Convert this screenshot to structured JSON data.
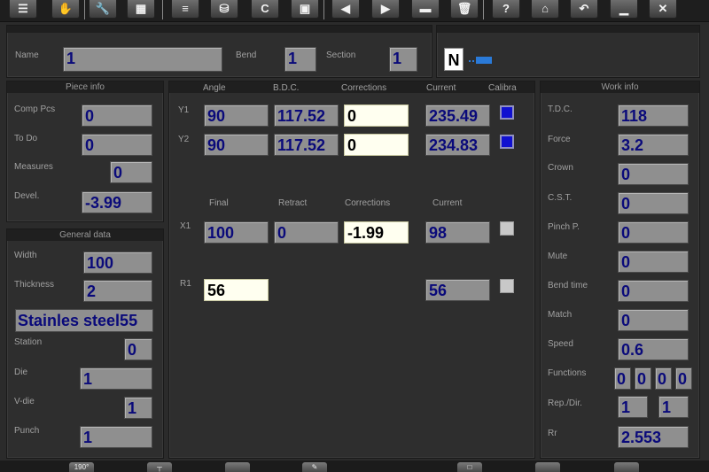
{
  "toolbar": {
    "icons": [
      "list-icon",
      "hand-icon",
      "wrench-icon",
      "calculator-icon",
      "layers-icon",
      "database-icon",
      "c-icon",
      "save-icon",
      "arrow-left-icon",
      "arrow-right-icon",
      "card-icon",
      "trash-icon",
      "help-icon",
      "home-icon",
      "undo-icon",
      "minimize-icon",
      "close-icon"
    ],
    "c_label": "C",
    "help_label": "?"
  },
  "header": {
    "name_label": "Name",
    "name_value": "1",
    "bend_label": "Bend",
    "bend_value": "1",
    "section_label": "Section",
    "section_value": "1",
    "mode_value": "N"
  },
  "piece_info": {
    "title": "Piece info",
    "comp_pcs_label": "Comp Pcs",
    "comp_pcs_value": "0",
    "to_do_label": "To Do",
    "to_do_value": "0",
    "measures_label": "Measures",
    "measures_value": "0",
    "devel_label": "Devel.",
    "devel_value": "-3.99"
  },
  "general_data": {
    "title": "General data",
    "width_label": "Width",
    "width_value": "100",
    "thickness_label": "Thickness",
    "thickness_value": "2",
    "material_value": "Stainles steel55",
    "station_label": "Station",
    "station_value": "0",
    "die_label": "Die",
    "die_value": "1",
    "vdie_label": "V-die",
    "vdie_value": "1",
    "punch_label": "Punch",
    "punch_value": "1"
  },
  "axes": {
    "col_angle": "Angle",
    "col_bdc": "B.D.C.",
    "col_corrections": "Corrections",
    "col_current": "Current",
    "col_calibra": "Calibra",
    "y1_label": "Y1",
    "y1_angle": "90",
    "y1_bdc": "117.52",
    "y1_corr": "0",
    "y1_current": "235.49",
    "y1_calibra": true,
    "y2_label": "Y2",
    "y2_angle": "90",
    "y2_bdc": "117.52",
    "y2_corr": "0",
    "y2_current": "234.83",
    "y2_calibra": true,
    "col_final": "Final",
    "col_retract": "Retract",
    "col_corrections2": "Corrections",
    "col_current2": "Current",
    "x1_label": "X1",
    "x1_final": "100",
    "x1_retract": "0",
    "x1_corr": "-1.99",
    "x1_current": "98",
    "x1_calibra": false,
    "r1_label": "R1",
    "r1_final": "56",
    "r1_current": "56",
    "r1_calibra": false
  },
  "work_info": {
    "title": "Work info",
    "tdc_label": "T.D.C.",
    "tdc_value": "118",
    "force_label": "Force",
    "force_value": "3.2",
    "crown_label": "Crown",
    "crown_value": "0",
    "cst_label": "C.S.T.",
    "cst_value": "0",
    "pinch_label": "Pinch P.",
    "pinch_value": "0",
    "mute_label": "Mute",
    "mute_value": "0",
    "bend_time_label": "Bend time",
    "bend_time_value": "0",
    "match_label": "Match",
    "match_value": "0",
    "speed_label": "Speed",
    "speed_value": "0.6",
    "functions_label": "Functions",
    "functions_values": [
      "0",
      "0",
      "0",
      "0"
    ],
    "rep_dir_label": "Rep./Dir.",
    "rep_value": "1",
    "dir_value": "1",
    "rr_label": "Rr",
    "rr_value": "2.553"
  },
  "bottombar": {
    "angle_button_label": "190°"
  }
}
